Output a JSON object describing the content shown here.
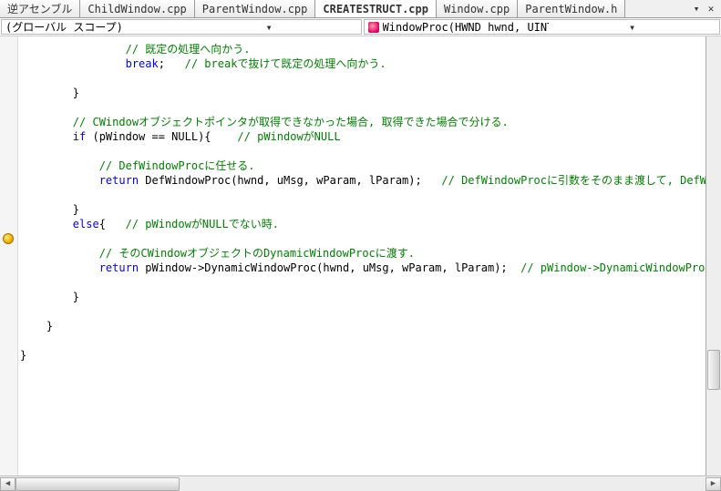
{
  "tabs": {
    "items": [
      {
        "label": "逆アセンブル",
        "active": false
      },
      {
        "label": "ChildWindow.cpp",
        "active": false
      },
      {
        "label": "ParentWindow.cpp",
        "active": false
      },
      {
        "label": "CREATESTRUCT.cpp",
        "active": true
      },
      {
        "label": "Window.cpp",
        "active": false
      },
      {
        "label": "ParentWindow.h",
        "active": false
      }
    ],
    "dropdown_glyph": "▾",
    "close_glyph": "✕"
  },
  "scope": {
    "left_label": "(グローバル スコープ)",
    "right_label": "WindowProc(HWND hwnd, UINT uMsg, WPARAM wParam,",
    "dropdown_glyph": "▾"
  },
  "breakpoint_line_index": 13,
  "code_lines": [
    {
      "indent": 16,
      "segs": [
        {
          "cls": "cm",
          "t": "// 既定の処理へ向かう."
        }
      ]
    },
    {
      "indent": 16,
      "segs": [
        {
          "cls": "kw",
          "t": "break"
        },
        {
          "cls": "",
          "t": ";   "
        },
        {
          "cls": "cm",
          "t": "// breakで抜けて既定の処理へ向かう."
        }
      ]
    },
    {
      "indent": 0,
      "segs": []
    },
    {
      "indent": 8,
      "segs": [
        {
          "cls": "",
          "t": "}"
        }
      ]
    },
    {
      "indent": 0,
      "segs": []
    },
    {
      "indent": 8,
      "segs": [
        {
          "cls": "cm",
          "t": "// CWindowオブジェクトポインタが取得できなかった場合, 取得できた場合で分ける."
        }
      ]
    },
    {
      "indent": 8,
      "segs": [
        {
          "cls": "kw",
          "t": "if"
        },
        {
          "cls": "",
          "t": " (pWindow == NULL){    "
        },
        {
          "cls": "cm",
          "t": "// pWindowがNULL"
        }
      ]
    },
    {
      "indent": 0,
      "segs": []
    },
    {
      "indent": 12,
      "segs": [
        {
          "cls": "cm",
          "t": "// DefWindowProcに任せる."
        }
      ]
    },
    {
      "indent": 12,
      "segs": [
        {
          "cls": "kw",
          "t": "return"
        },
        {
          "cls": "",
          "t": " DefWindowProc(hwnd, uMsg, wParam, lParam);   "
        },
        {
          "cls": "cm",
          "t": "// DefWindowProcに引数をそのまま渡して, DefW"
        }
      ]
    },
    {
      "indent": 0,
      "segs": []
    },
    {
      "indent": 8,
      "segs": [
        {
          "cls": "",
          "t": "}"
        }
      ]
    },
    {
      "indent": 8,
      "segs": [
        {
          "cls": "kw",
          "t": "else"
        },
        {
          "cls": "",
          "t": "{   "
        },
        {
          "cls": "cm",
          "t": "// pWindowがNULLでない時."
        }
      ]
    },
    {
      "indent": 0,
      "segs": []
    },
    {
      "indent": 12,
      "segs": [
        {
          "cls": "cm",
          "t": "// そのCWindowオブジェクトのDynamicWindowProcに渡す."
        }
      ]
    },
    {
      "indent": 12,
      "segs": [
        {
          "cls": "kw",
          "t": "return"
        },
        {
          "cls": "",
          "t": " pWindow->DynamicWindowProc(hwnd, uMsg, wParam, lParam);  "
        },
        {
          "cls": "cm",
          "t": "// pWindow->DynamicWindowProcに引"
        }
      ]
    },
    {
      "indent": 0,
      "segs": []
    },
    {
      "indent": 8,
      "segs": [
        {
          "cls": "",
          "t": "}"
        }
      ]
    },
    {
      "indent": 0,
      "segs": []
    },
    {
      "indent": 4,
      "segs": [
        {
          "cls": "",
          "t": "}"
        }
      ]
    },
    {
      "indent": 0,
      "segs": []
    },
    {
      "indent": 0,
      "segs": [
        {
          "cls": "",
          "t": "}"
        }
      ]
    }
  ],
  "hscroll": {
    "left_arrow": "◀",
    "right_arrow": "▶"
  }
}
